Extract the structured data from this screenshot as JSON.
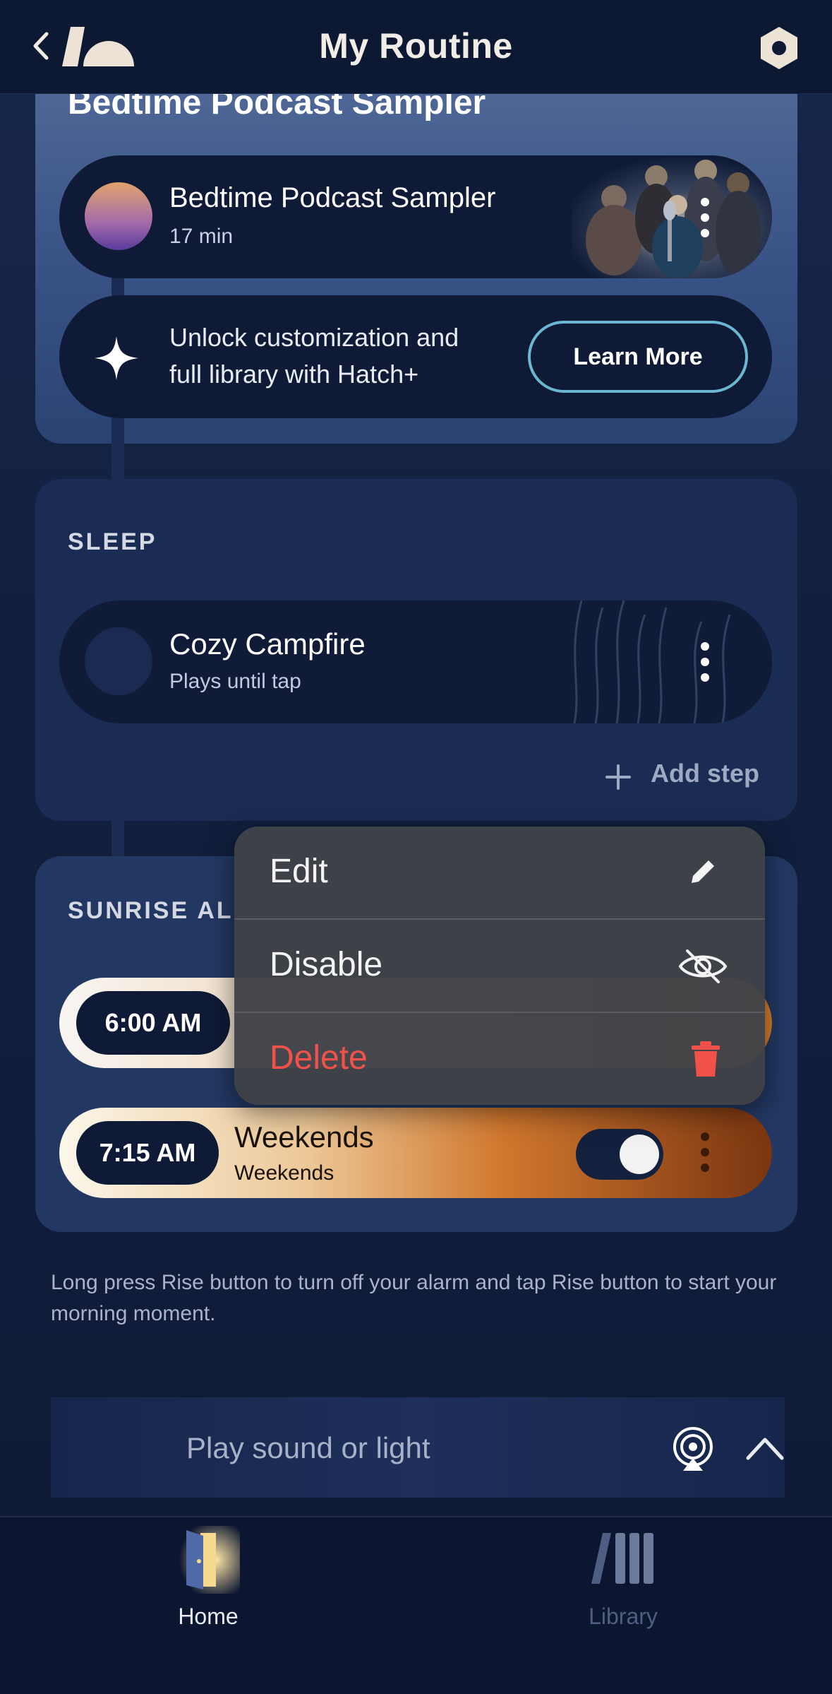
{
  "header": {
    "title": "My Routine",
    "back_icon": "chevron-left-icon",
    "settings_icon": "hexagon-settings-icon"
  },
  "wind_down": {
    "title": "Bedtime Podcast Sampler",
    "item": {
      "title": "Bedtime Podcast Sampler",
      "duration": "17 min"
    },
    "upsell": {
      "text_line1": "Unlock customization and",
      "text_line2": "full library with Hatch+",
      "button_label": "Learn More"
    }
  },
  "sleep": {
    "label": "SLEEP",
    "item": {
      "title": "Cozy Campfire",
      "subtitle": "Plays until tap"
    },
    "add_step_label": "Add step"
  },
  "sunrise": {
    "label": "SUNRISE AL",
    "alarms": [
      {
        "time": "6:00 AM"
      },
      {
        "time": "7:15 AM",
        "title": "Weekends",
        "subtitle": "Weekends",
        "enabled": true
      }
    ]
  },
  "menu": {
    "items": [
      {
        "label": "Edit",
        "icon": "pencil-icon",
        "color": "#f3f3f3"
      },
      {
        "label": "Disable",
        "icon": "eye-slash-icon",
        "color": "#f3f3f3"
      },
      {
        "label": "Delete",
        "icon": "trash-icon",
        "color": "#f0524a"
      }
    ]
  },
  "info_text": "Long press Rise button to turn off your alarm and tap Rise button to start your morning moment.",
  "play_bar": {
    "label": "Play sound or light"
  },
  "tabs": [
    {
      "label": "Home",
      "icon": "door-home-icon",
      "active": true
    },
    {
      "label": "Library",
      "icon": "library-books-icon",
      "active": false
    }
  ],
  "colors": {
    "accent_outline": "#6bb7d1",
    "delete": "#f0524a",
    "background": "#0f1a35"
  }
}
